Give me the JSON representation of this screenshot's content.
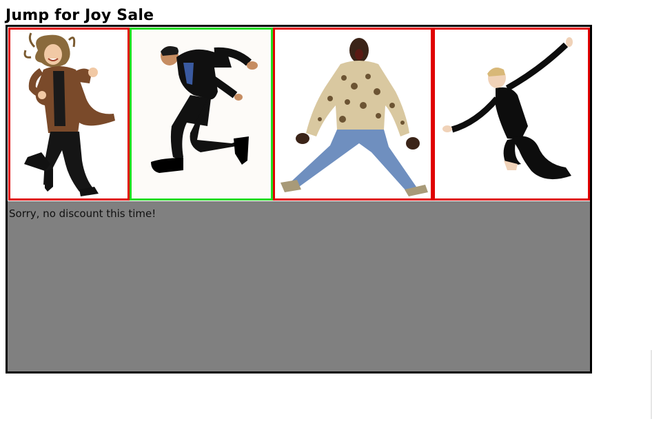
{
  "page": {
    "title": "Jump for Joy Sale"
  },
  "gallery": {
    "photos": [
      {
        "name": "woman in brown jacket jumping",
        "state": "not-selected",
        "border_color": "#e00000"
      },
      {
        "name": "man in black suit jumping",
        "state": "selected",
        "border_color": "#22dd22"
      },
      {
        "name": "man in patterned shirt jumping",
        "state": "not-selected",
        "border_color": "#e00000"
      },
      {
        "name": "woman in black leotard leaping",
        "state": "not-selected",
        "border_color": "#e00000"
      }
    ]
  },
  "result": {
    "message": "Sorry, no discount this time!",
    "panel_color": "#808080"
  }
}
